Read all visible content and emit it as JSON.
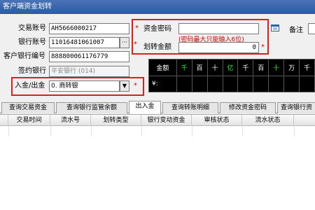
{
  "window": {
    "title": "客户端资金划转"
  },
  "form": {
    "trade_account_label": "交易账号",
    "trade_account_value": "AH5666000217",
    "bank_account_label": "银行账号",
    "bank_account_value": "11016481061007",
    "bank_account_btn": "···",
    "customer_bank_no_label": "客户银行编号",
    "customer_bank_no_value": "888800061176779",
    "contract_bank_label": "签约银行",
    "contract_bank_value": "平安银行 (014)",
    "direction_label": "入金/出金",
    "direction_value": "0. 商转银",
    "direction_arrow": "▼",
    "fund_password_label": "资金密码",
    "fund_password_hint": "(密码最大只能输入6位)",
    "transfer_amount_label": "划转金额",
    "transfer_amount_value": "0",
    "required_mark": "*",
    "remark_label": "备注",
    "calendar_icon": "calendar-icon"
  },
  "amount_grid": {
    "header": [
      "金额",
      "千",
      "百",
      "十",
      "亿",
      "千",
      "百",
      "十",
      "万",
      "千"
    ],
    "row2_label": "¥:"
  },
  "tabs": [
    {
      "label": "查询交易资金"
    },
    {
      "label": "查询银行监管余额"
    },
    {
      "label": "出入金"
    },
    {
      "label": "查询转账明细"
    },
    {
      "label": "修改资金密码"
    },
    {
      "label": "查询银行资"
    }
  ],
  "table": {
    "columns": [
      "交易时间",
      "流水号",
      "划转类型",
      "银行变动资金",
      "审核状态",
      "流水状态"
    ]
  },
  "colors": {
    "highlight_border": "#d82020",
    "grid_digit": "#22ff22",
    "required": "#d40000"
  }
}
